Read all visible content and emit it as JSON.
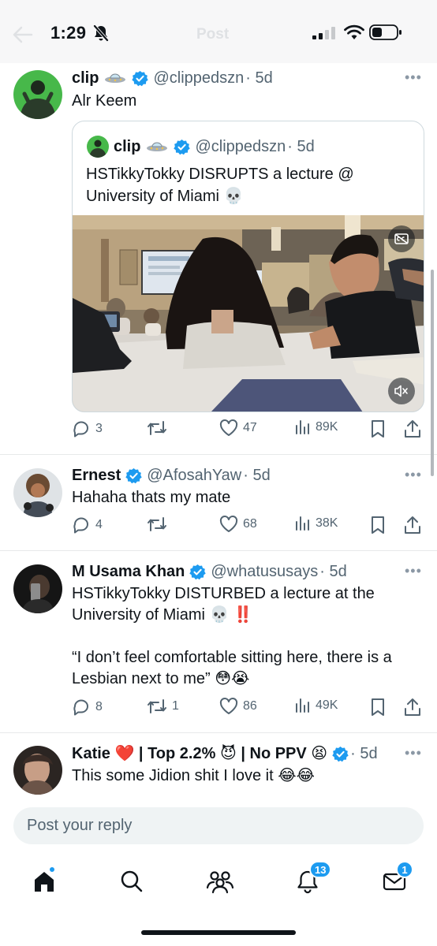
{
  "status_bar": {
    "time": "1:29"
  },
  "header": {
    "title": "Post"
  },
  "tweets": [
    {
      "name": "clip",
      "handle": "@clippedszn",
      "time": "· 5d",
      "text": "Alr Keem",
      "quote": {
        "name": "clip",
        "handle": "@clippedszn",
        "time": "· 5d",
        "text": "HSTikkyTokky DISRUPTS a lecture @ University of Miami 💀"
      },
      "stats": {
        "replies": "3",
        "reposts": "",
        "likes": "47",
        "views": "89K"
      }
    },
    {
      "name": "Ernest",
      "handle": "@AfosahYaw",
      "time": "· 5d",
      "text": "Hahaha thats my mate",
      "stats": {
        "replies": "4",
        "reposts": "",
        "likes": "68",
        "views": "38K"
      }
    },
    {
      "name": "M Usama Khan",
      "handle": "@whatususays",
      "time": "· 5d",
      "text": "HSTikkyTokky DISTURBED a lecture at the University of Miami 💀 ‼️\n\n“I don’t feel comfortable sitting here, there is a Lesbian next to me” 😳😭",
      "stats": {
        "replies": "8",
        "reposts": "1",
        "likes": "86",
        "views": "49K"
      }
    },
    {
      "name": "Katie ❤️ | Top 2.2% 😈 | No PPV 😫",
      "handle": "",
      "time": "· 5d",
      "text": "This some Jidion shit I love it 😂😂"
    }
  ],
  "reply_bar": {
    "placeholder": "Post your reply"
  },
  "tab_bar": {
    "notifications_badge": "13",
    "messages_badge": "1"
  },
  "colors": {
    "accent": "#1d9bf0",
    "text": "#0f1419",
    "secondary": "#536471",
    "divider": "#e7e9ea"
  }
}
